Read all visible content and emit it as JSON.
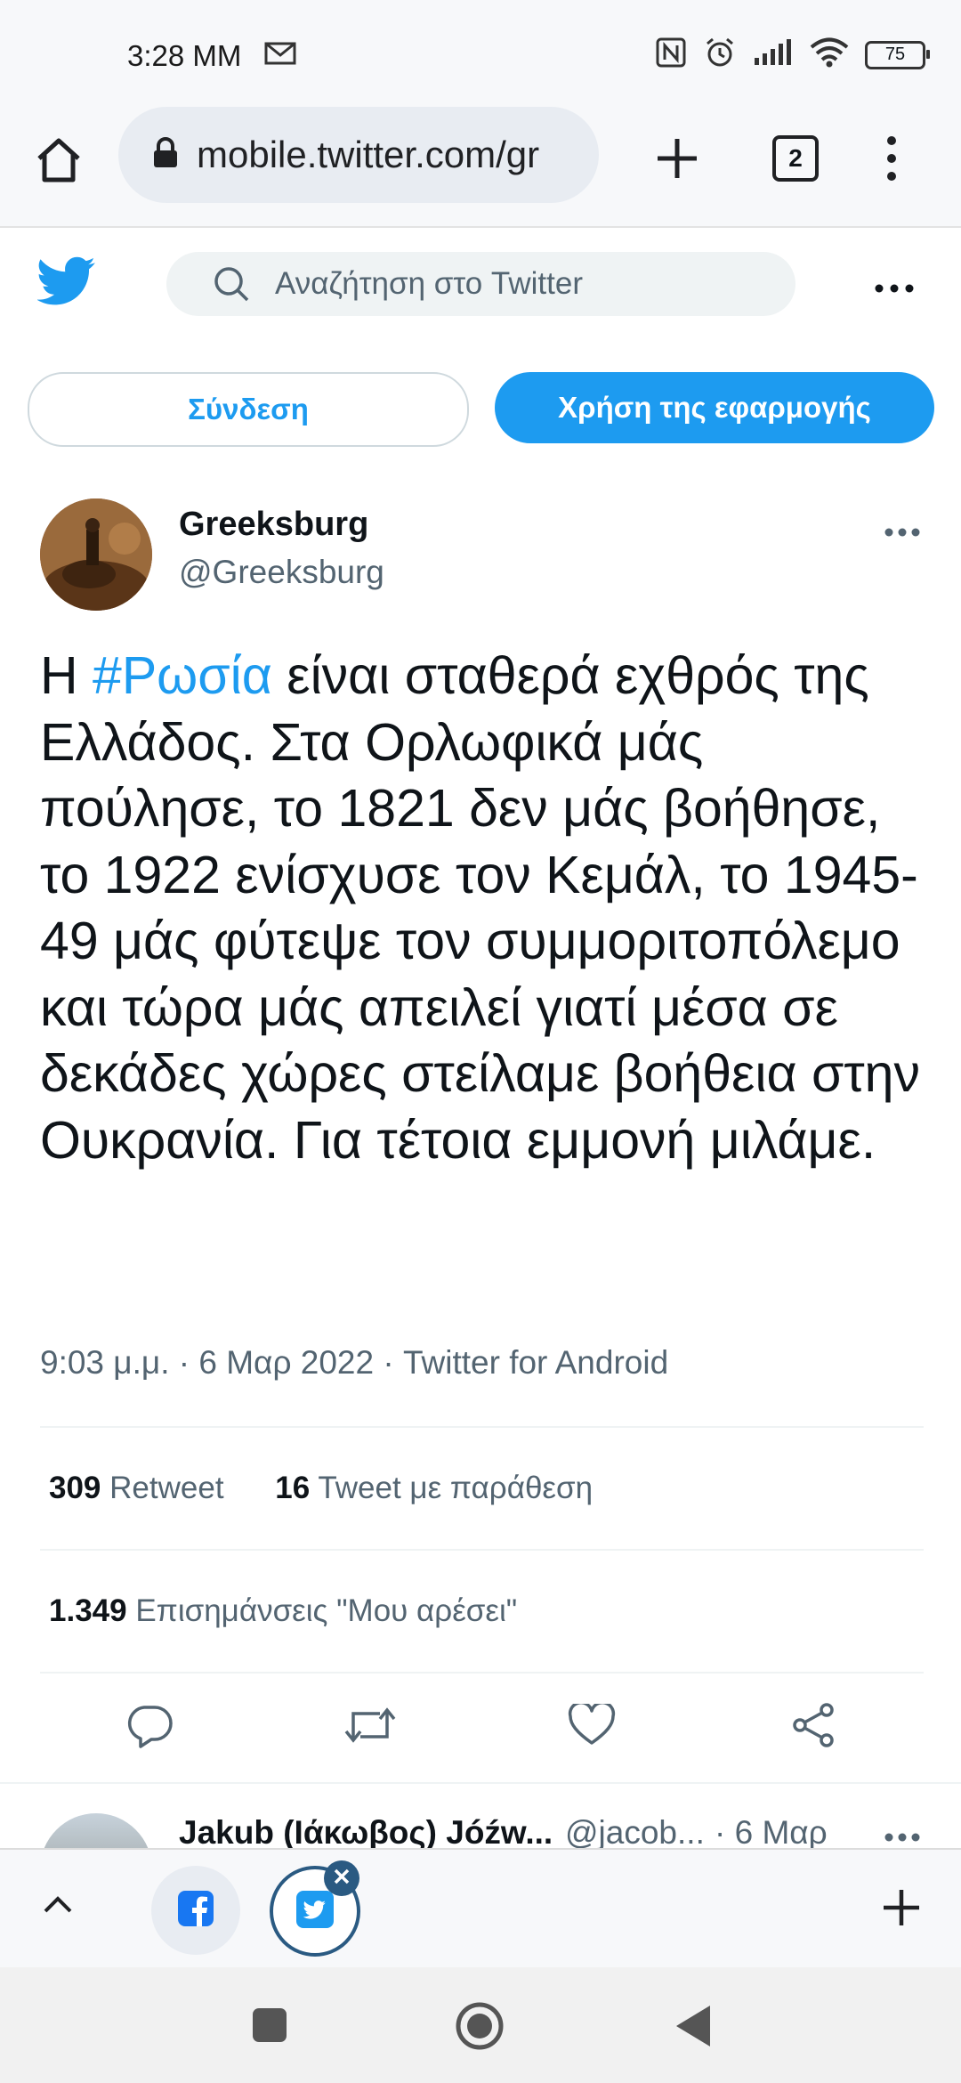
{
  "status_bar": {
    "time": "3:28 MM",
    "battery": "75"
  },
  "browser": {
    "url": "mobile.twitter.com/gr",
    "tab_count": "2"
  },
  "header": {
    "search_placeholder": "Αναζήτηση στο Twitter",
    "login_label": "Σύνδεση",
    "use_app_label": "Χρήση της εφαρμογής"
  },
  "tweet": {
    "display_name": "Greeksburg",
    "handle": "@Greeksburg",
    "text_prefix": "Η ",
    "hashtag": "#Ρωσία",
    "text_rest": " είναι σταθερά εχθρός της Ελλάδος. Στα Ορλωφικά μάς πούλησε, το 1821 δεν μάς βοήθησε, το 1922 ενίσχυσε τον Κεμάλ, το 1945-49 μάς φύτεψε τον συμμοριτοπόλεμο και τώρα μάς απειλεί γιατί μέσα σε δεκάδες χώρες στείλαμε βοήθεια στην Ουκρανία. Για τέτοια εμμονή μιλάμε.",
    "meta": "9:03 μ.μ. · 6 Μαρ 2022 · Twitter for Android",
    "retweets_count": "309",
    "retweets_label": "Retweet",
    "quotes_count": "16",
    "quotes_label": "Tweet με παράθεση",
    "likes_count": "1.349",
    "likes_label": "Επισημάνσεις \"Μου αρέσει\""
  },
  "reply_preview": {
    "name": "Jakub (Ιάκωβος) Jóźw...",
    "handle": "@jacob...",
    "date": "· 6 Μαρ"
  },
  "colors": {
    "twitter_blue": "#1d9bf0",
    "secondary_text": "#536471"
  }
}
